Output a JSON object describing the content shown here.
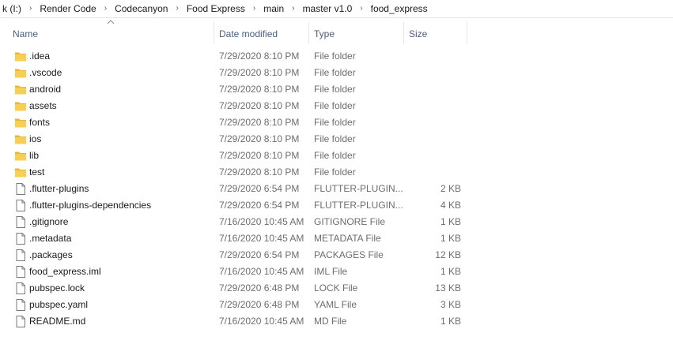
{
  "breadcrumb": {
    "items": [
      "k (I:)",
      "Render Code",
      "Codecanyon",
      "Food Express",
      "main",
      "master v1.0",
      "food_express"
    ],
    "separator": "›"
  },
  "columns": {
    "name": "Name",
    "date": "Date modified",
    "type": "Type",
    "size": "Size"
  },
  "colors": {
    "folder": "#f7cf55",
    "folder_dark": "#e8b63a",
    "header_text": "#4c607a",
    "secondary_text": "#6d6d6d"
  },
  "files": [
    {
      "name": ".idea",
      "date": "7/29/2020 8:10 PM",
      "type": "File folder",
      "size": "",
      "icon": "folder-icon"
    },
    {
      "name": ".vscode",
      "date": "7/29/2020 8:10 PM",
      "type": "File folder",
      "size": "",
      "icon": "folder-icon"
    },
    {
      "name": "android",
      "date": "7/29/2020 8:10 PM",
      "type": "File folder",
      "size": "",
      "icon": "folder-icon"
    },
    {
      "name": "assets",
      "date": "7/29/2020 8:10 PM",
      "type": "File folder",
      "size": "",
      "icon": "folder-icon"
    },
    {
      "name": "fonts",
      "date": "7/29/2020 8:10 PM",
      "type": "File folder",
      "size": "",
      "icon": "folder-icon"
    },
    {
      "name": "ios",
      "date": "7/29/2020 8:10 PM",
      "type": "File folder",
      "size": "",
      "icon": "folder-icon"
    },
    {
      "name": "lib",
      "date": "7/29/2020 8:10 PM",
      "type": "File folder",
      "size": "",
      "icon": "folder-icon"
    },
    {
      "name": "test",
      "date": "7/29/2020 8:10 PM",
      "type": "File folder",
      "size": "",
      "icon": "folder-icon"
    },
    {
      "name": ".flutter-plugins",
      "date": "7/29/2020 6:54 PM",
      "type": "FLUTTER-PLUGIN...",
      "size": "2 KB",
      "icon": "file-icon"
    },
    {
      "name": ".flutter-plugins-dependencies",
      "date": "7/29/2020 6:54 PM",
      "type": "FLUTTER-PLUGIN...",
      "size": "4 KB",
      "icon": "file-icon"
    },
    {
      "name": ".gitignore",
      "date": "7/16/2020 10:45 AM",
      "type": "GITIGNORE File",
      "size": "1 KB",
      "icon": "file-icon"
    },
    {
      "name": ".metadata",
      "date": "7/16/2020 10:45 AM",
      "type": "METADATA File",
      "size": "1 KB",
      "icon": "file-icon"
    },
    {
      "name": ".packages",
      "date": "7/29/2020 6:54 PM",
      "type": "PACKAGES File",
      "size": "12 KB",
      "icon": "file-icon"
    },
    {
      "name": "food_express.iml",
      "date": "7/16/2020 10:45 AM",
      "type": "IML File",
      "size": "1 KB",
      "icon": "file-icon"
    },
    {
      "name": "pubspec.lock",
      "date": "7/29/2020 6:48 PM",
      "type": "LOCK File",
      "size": "13 KB",
      "icon": "file-icon"
    },
    {
      "name": "pubspec.yaml",
      "date": "7/29/2020 6:48 PM",
      "type": "YAML File",
      "size": "3 KB",
      "icon": "file-icon"
    },
    {
      "name": "README.md",
      "date": "7/16/2020 10:45 AM",
      "type": "MD File",
      "size": "1 KB",
      "icon": "file-icon"
    }
  ]
}
